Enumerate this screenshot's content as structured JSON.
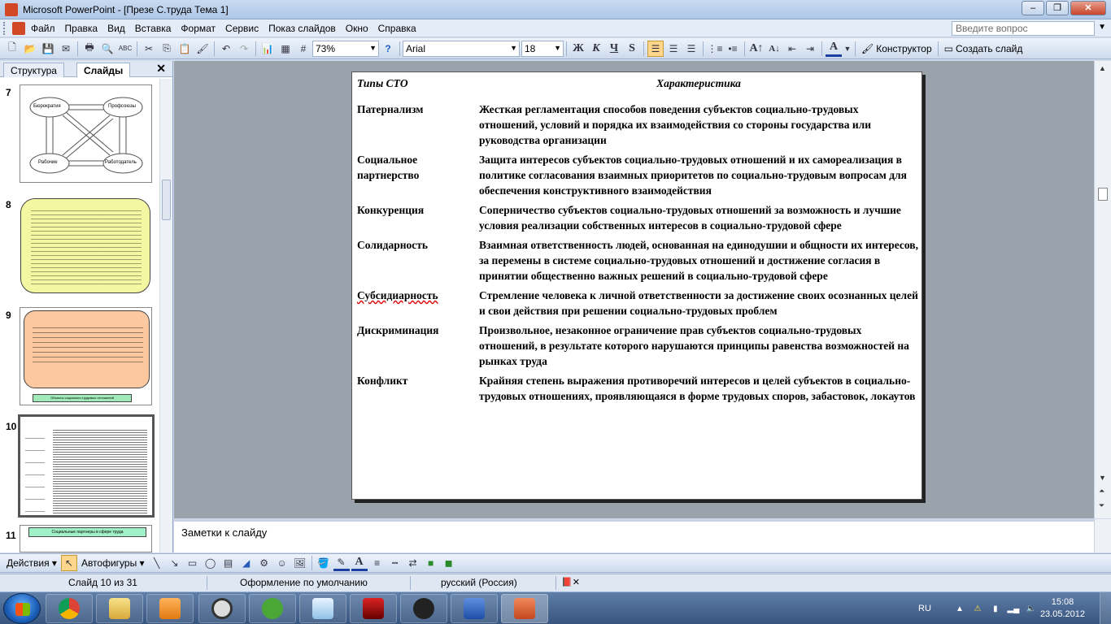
{
  "window": {
    "title": "Microsoft PowerPoint - [Презе С.труда Тема 1]"
  },
  "menu": {
    "items": [
      "Файл",
      "Правка",
      "Вид",
      "Вставка",
      "Формат",
      "Сервис",
      "Показ слайдов",
      "Окно",
      "Справка"
    ],
    "help_placeholder": "Введите вопрос"
  },
  "toolbar": {
    "zoom": "73%",
    "font": "Arial",
    "font_size": "18",
    "bold": "Ж",
    "italic": "К",
    "underline": "Ч",
    "shadow": "S",
    "designer_label": "Конструктор",
    "new_slide_label": "Создать слайд"
  },
  "left_pane": {
    "tabs": [
      "Структура",
      "Слайды"
    ],
    "active_tab": "Слайды",
    "slide_numbers": [
      "7",
      "8",
      "9",
      "10",
      "11"
    ],
    "thumb7_boxes": [
      "Бюрократия",
      "Профсоюзы",
      "Рабочие",
      "Работодатель"
    ],
    "thumb9_caption": "Объекты социально-трудовых отношений",
    "thumb11_caption": "Социальные партнеры в сфере труда"
  },
  "slide": {
    "header_type": "Типы СТО",
    "header_char": "Характеристика",
    "rows": [
      {
        "type": "Патернализм",
        "text": "Жесткая регламентация способов поведения субъектов социально-трудовых отношений, условий и порядка их взаимодействия со стороны государства или руководства организации"
      },
      {
        "type": "Социальное партнерство",
        "text": "Защита интересов субъектов социально-трудовых отношений и их самореализация в политике согласования взаимных приоритетов по социально-трудовым вопросам для обеспечения конструктивного взаимодействия"
      },
      {
        "type": "Конкуренция",
        "text": "Соперничество субъектов социально-трудовых отношений за возможность и лучшие условия реализации собственных интересов в социально-трудовой сфере"
      },
      {
        "type": "Солидарность",
        "text": "Взаимная ответственность людей, основанная на единодушии и общности их интересов, за перемены в системе социально-трудовых отношений и достижение согласия в принятии общественно важных решений в социально-трудовой сфере"
      },
      {
        "type": "Субсидиарность",
        "text": "Стремление человека к личной ответственности за достижение своих осознанных целей и свои действия при решении социально-трудовых проблем"
      },
      {
        "type": "Дискриминация",
        "text": "Произвольное, незаконное ограничение прав субъектов социально-трудовых отношений, в результате которого нарушаются принципы равенства возможностей на рынках труда"
      },
      {
        "type": "Конфликт",
        "text": "Крайняя степень выражения противоречий интересов и целей субъектов в социально-трудовых отношениях, проявляющаяся в форме трудовых споров, забастовок, локаутов"
      }
    ]
  },
  "notes": {
    "placeholder": "Заметки к слайду"
  },
  "draw_toolbar": {
    "actions": "Действия",
    "autoshapes": "Автофигуры"
  },
  "status": {
    "slide": "Слайд 10 из 31",
    "design": "Оформление по умолчанию",
    "language": "русский (Россия)"
  },
  "taskbar": {
    "lang": "RU",
    "time": "15:08",
    "date": "23.05.2012"
  }
}
